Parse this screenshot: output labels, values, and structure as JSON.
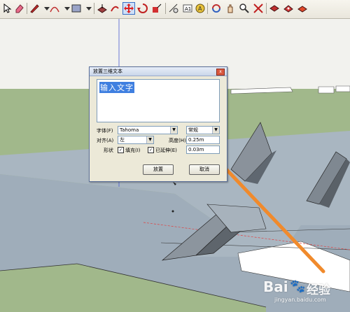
{
  "toolbar": {
    "icons": [
      "eraser",
      "pencil",
      "arc",
      "rectangle",
      "push-pull",
      "follow-me",
      "move",
      "rotate",
      "scale",
      "text",
      "3d-text",
      "paint-bucket",
      "orbit",
      "pan",
      "zoom",
      "zoom-extents",
      "components",
      "warehouse"
    ]
  },
  "dialog": {
    "title": "放置三维文本",
    "close_label": "x",
    "input_text": "输入文字",
    "font_label": "字体(F)",
    "font_value": "Tahoma",
    "style_value": "常规",
    "align_label": "对齐(A)",
    "align_value": "左",
    "height_label": "高度(H)",
    "height_value": "0.25m",
    "form_label": "形状",
    "fill_label": "填充(I)",
    "extruded_label": "已延伸(E)",
    "extrude_value": "0.03m",
    "place_button": "放置",
    "cancel_button": "取消"
  },
  "watermark": {
    "brand": "Bai",
    "suffix": "经验",
    "url": "jingyan.baidu.com"
  },
  "colors": {
    "sky": "#f2f2ee",
    "ground": "#a1b88b",
    "plane": "#a9b6c1",
    "arrow": "#f08a2c",
    "selection": "#3f7fe0"
  }
}
